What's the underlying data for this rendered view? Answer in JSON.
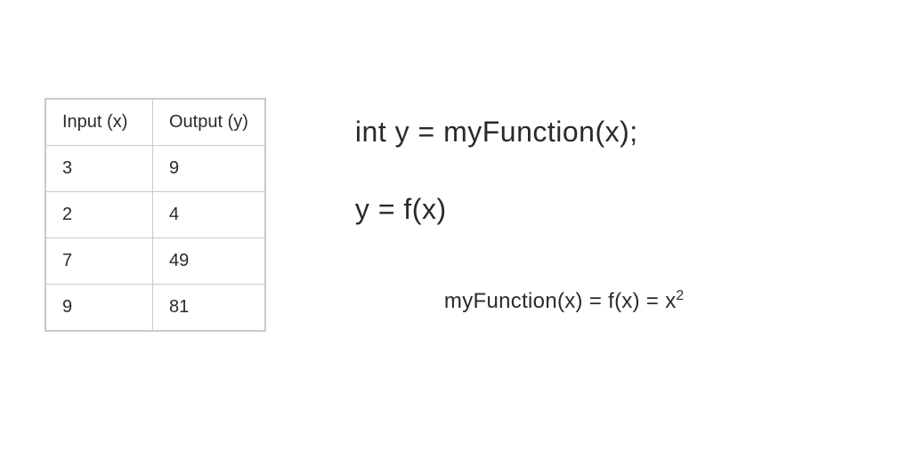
{
  "chart_data": {
    "type": "table",
    "columns": [
      "Input (x)",
      "Output (y)"
    ],
    "rows": [
      [
        "3",
        "9"
      ],
      [
        "2",
        "4"
      ],
      [
        "7",
        "49"
      ],
      [
        "9",
        "81"
      ]
    ]
  },
  "equations": {
    "line1": "int y = myFunction(x);",
    "line2": "y = f(x)",
    "line3_prefix": "myFunction(x) = f(x) = x",
    "line3_exponent": "2"
  }
}
